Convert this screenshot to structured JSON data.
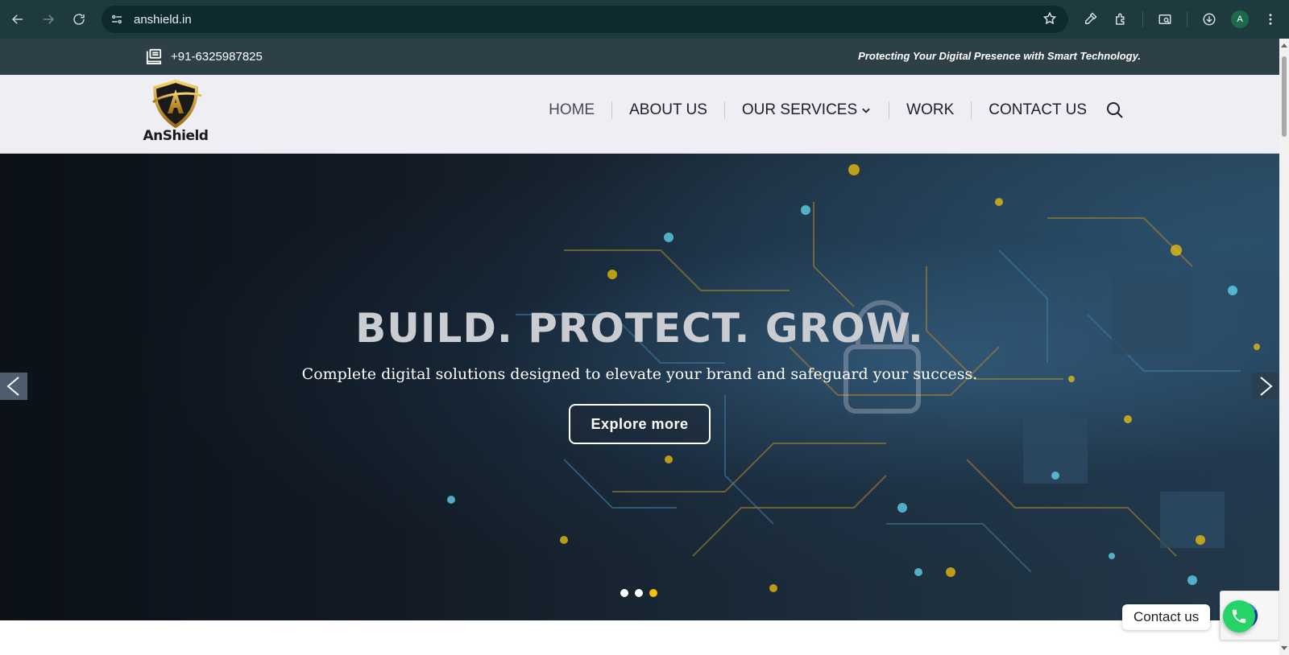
{
  "browser": {
    "url": "anshield.in",
    "profile_initial": "A"
  },
  "topbar": {
    "phone": "+91-6325987825",
    "tagline": "Protecting Your Digital Presence with Smart Technology."
  },
  "header": {
    "logo_text": "AnShield",
    "nav": [
      {
        "label": "HOME"
      },
      {
        "label": "ABOUT US"
      },
      {
        "label": "OUR SERVICES"
      },
      {
        "label": "WORK"
      },
      {
        "label": "CONTACT US"
      }
    ]
  },
  "hero": {
    "title": "BUILD. PROTECT. GROW.",
    "subtitle": "Complete digital solutions designed to elevate your brand and safeguard your success.",
    "cta_label": "Explore more",
    "slide_count": 3,
    "active_slide": 3,
    "accent_color": "#f2c20c"
  },
  "contact_widget": {
    "label": "Contact us",
    "color": "#25d366"
  }
}
